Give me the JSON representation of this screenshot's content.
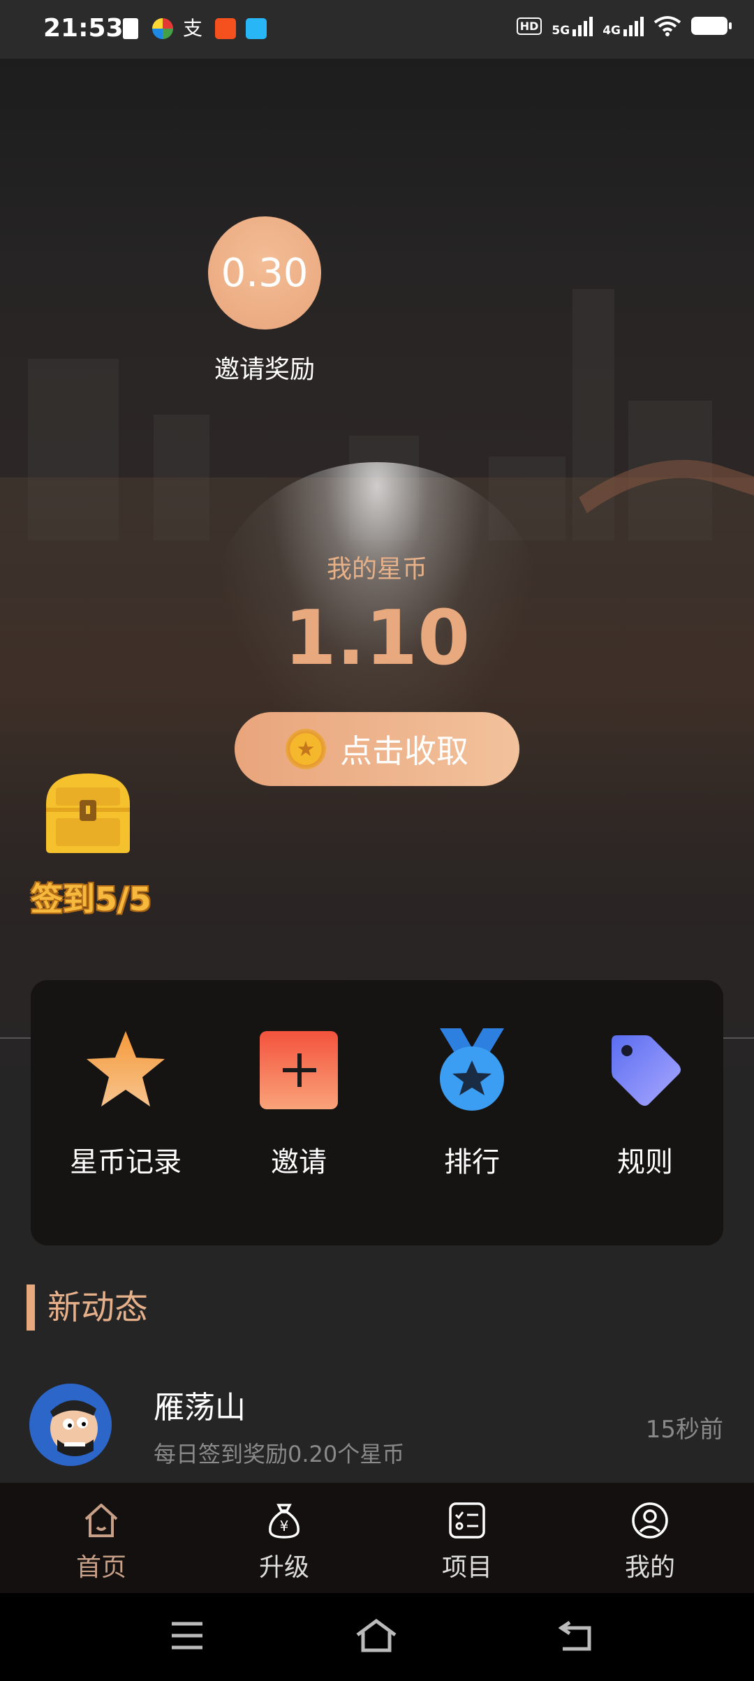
{
  "status_bar": {
    "time": "21:53",
    "network_1": "5G",
    "network_2": "4G",
    "hd_label": "HD"
  },
  "invite_reward": {
    "value": "0.30",
    "label": "邀请奖励"
  },
  "coins": {
    "title": "我的星币",
    "value": "1.10",
    "collect_label": "点击收取"
  },
  "checkin": {
    "label": "签到5/5"
  },
  "menu": {
    "items": [
      {
        "label": "星币记录",
        "icon": "star-icon"
      },
      {
        "label": "邀请",
        "icon": "plus-icon"
      },
      {
        "label": "排行",
        "icon": "medal-icon"
      },
      {
        "label": "规则",
        "icon": "tag-icon"
      }
    ]
  },
  "feed": {
    "section_title": "新动态",
    "items": [
      {
        "name": "雁荡山",
        "desc": "每日签到奖励0.20个星币",
        "time": "15秒前"
      }
    ]
  },
  "tabbar": {
    "items": [
      {
        "label": "首页",
        "icon": "home-icon"
      },
      {
        "label": "升级",
        "icon": "moneybag-icon"
      },
      {
        "label": "项目",
        "icon": "checklist-icon"
      },
      {
        "label": "我的",
        "icon": "profile-icon"
      }
    ]
  },
  "colors": {
    "accent": "#e9a97f",
    "checkin": "#f7b93d"
  }
}
